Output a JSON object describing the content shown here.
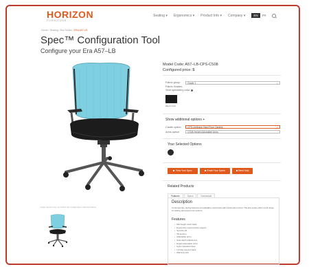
{
  "header": {
    "logo": "HORIZON",
    "logo_sub": "FURNITURE",
    "nav": [
      "Seating ▾",
      "Ergonomics ▾",
      "Product Info ▾",
      "Company ▾"
    ],
    "lang_active": "EN",
    "lang_other": "FR"
  },
  "breadcrumb": {
    "path": "Home / Seating / Era Series / ",
    "current": "ERA A57-LB"
  },
  "page": {
    "title": "Spec™ Configuration Tool",
    "subtitle": "Configure your Era A57–LB"
  },
  "product": {
    "model_code": "Model Code: A57–LB-CPS-CS08",
    "configured_price": "Configured price: $",
    "caption": "Image shown may not reflect the configuration selected below",
    "accent_color": "#e05a1e",
    "mesh_color": "#7ecfe0"
  },
  "options": {
    "fabric_group_label": "Fabric group",
    "fabric_group_value": "Grade 1",
    "fabric_grade_label": "Fabric Grades",
    "fabric_color_label": "Seat upholstery color",
    "swatch_label": "Black Cloth",
    "show_additional": "Show additional options +",
    "caster_label": "Caster option",
    "caster_value": "CPS-Urethane Hard Floor Casters",
    "arms_label": "Arms option",
    "arms_value": "CS08-Height Adjustable Arms",
    "selected_title": "Your Selected Options"
  },
  "buttons": {
    "view": "View Your Spec",
    "email": "Email Your Specs",
    "help": "Need help"
  },
  "related": {
    "title": "Related Products",
    "tabs": [
      "Features",
      "Specs",
      "Downloads"
    ],
    "desc_title": "Description",
    "desc_text": "Contemporary styling features a breathable mesh back with functional comfort. The Era series offers a full range of seating and ergonomic options.",
    "features_title": "Features",
    "features": [
      "Mid-height mesh back",
      "Ergonomic mesh lumbar support",
      "Synchro-tilt",
      "Tilt tension",
      "Adjustable arms",
      "Seat depth adjustment",
      "Height adjustable arms",
      "Nylon standard base",
      "Lumbar support back",
      "Warranty info"
    ]
  }
}
